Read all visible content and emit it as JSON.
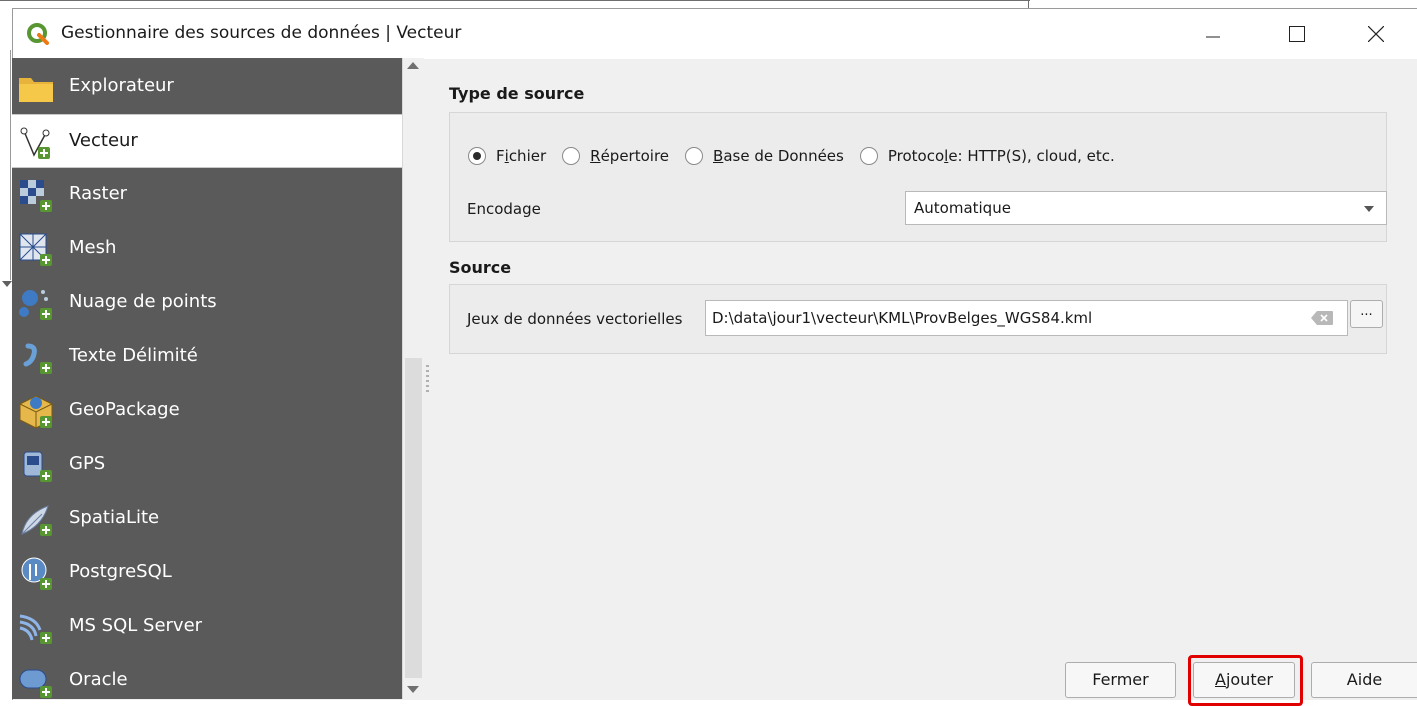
{
  "window": {
    "title": "Gestionnaire des sources de données | Vecteur",
    "controls": [
      "minimize",
      "maximize",
      "close"
    ]
  },
  "sidebar": {
    "items": [
      {
        "label": "Explorateur",
        "icon": "folder-icon",
        "active": false
      },
      {
        "label": "Vecteur",
        "icon": "vector-icon",
        "active": true
      },
      {
        "label": "Raster",
        "icon": "raster-icon",
        "active": false
      },
      {
        "label": "Mesh",
        "icon": "mesh-icon",
        "active": false
      },
      {
        "label": "Nuage de points",
        "icon": "point-cloud-icon",
        "active": false
      },
      {
        "label": "Texte Délimité",
        "icon": "delimited-text-icon",
        "active": false
      },
      {
        "label": "GeoPackage",
        "icon": "geopackage-icon",
        "active": false
      },
      {
        "label": "GPS",
        "icon": "gps-icon",
        "active": false
      },
      {
        "label": "SpatiaLite",
        "icon": "spatialite-icon",
        "active": false
      },
      {
        "label": "PostgreSQL",
        "icon": "postgresql-icon",
        "active": false
      },
      {
        "label": "MS SQL Server",
        "icon": "mssql-icon",
        "active": false
      },
      {
        "label": "Oracle",
        "icon": "oracle-icon",
        "active": false
      }
    ]
  },
  "source_type": {
    "title": "Type de source",
    "options": [
      {
        "pre": "F",
        "mn": "i",
        "post": "chier",
        "selected": true
      },
      {
        "pre": "",
        "mn": "R",
        "post": "épertoire",
        "selected": false
      },
      {
        "pre": "",
        "mn": "B",
        "post": "ase de Données",
        "selected": false
      },
      {
        "pre": "Protoco",
        "mn": "l",
        "post": "e: HTTP(S), cloud, etc.",
        "selected": false
      }
    ],
    "encoding_label": "Encodage",
    "encoding_value": "Automatique"
  },
  "source": {
    "title": "Source",
    "dataset_label": "Jeux de données vectorielles",
    "dataset_value": "D:\\data\\jour1\\vecteur\\KML\\ProvBelges_WGS84.kml",
    "browse_label": "..."
  },
  "buttons": {
    "close": "Fermer",
    "add_mn": "A",
    "add_rest": "jouter",
    "help": "Aide"
  },
  "colors": {
    "sidebar_bg": "#5a5a5a",
    "highlight": "#e00000",
    "qgis_green": "#589632"
  }
}
